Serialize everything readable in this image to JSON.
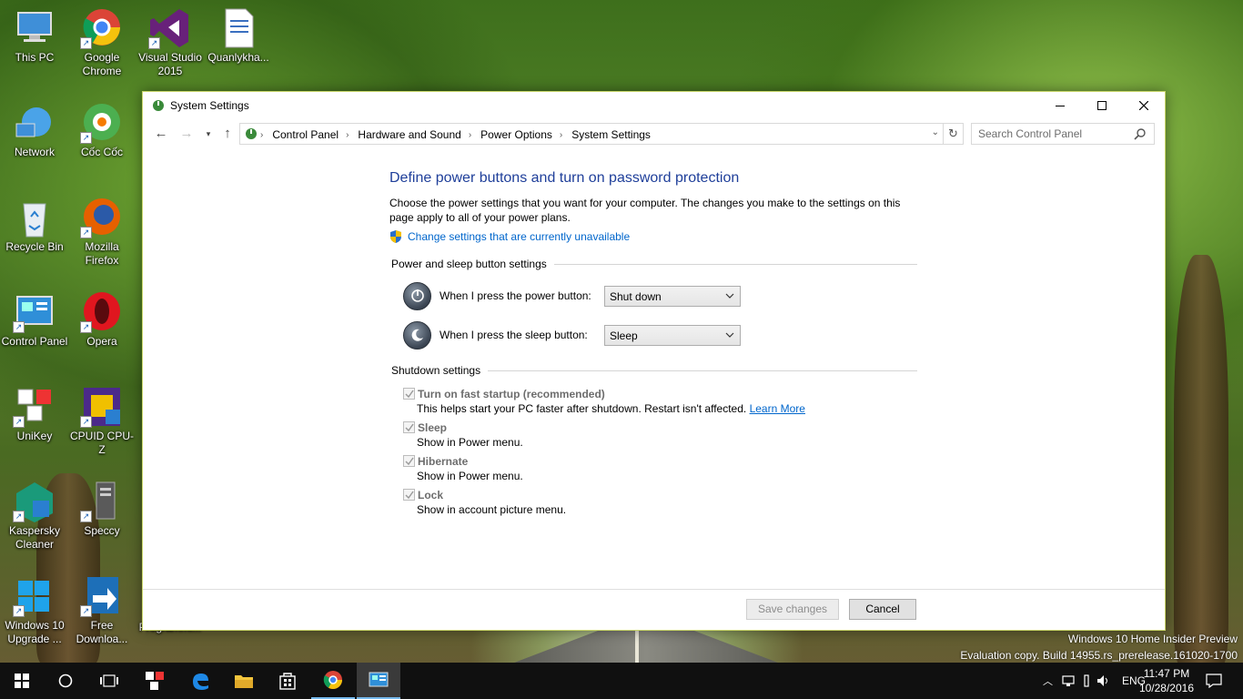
{
  "desktop": {
    "icons": [
      {
        "label": "This PC"
      },
      {
        "label": "Network"
      },
      {
        "label": "Recycle Bin"
      },
      {
        "label": "Control Panel"
      },
      {
        "label": "UniKey"
      },
      {
        "label": "Kaspersky Cleaner"
      },
      {
        "label": "Windows 10 Upgrade ..."
      },
      {
        "label": "Google Chrome"
      },
      {
        "label": "Cốc Cốc"
      },
      {
        "label": "Mozilla Firefox"
      },
      {
        "label": "Opera"
      },
      {
        "label": "CPUID CPU-Z"
      },
      {
        "label": "Speccy"
      },
      {
        "label": "Free Downloa..."
      },
      {
        "label": "Visual Studio 2015"
      },
      {
        "label": "Quanlykha..."
      },
      {
        "label": "Programmi..."
      }
    ]
  },
  "window": {
    "title": "System Settings",
    "breadcrumb": [
      "Control Panel",
      "Hardware and Sound",
      "Power Options",
      "System Settings"
    ],
    "search_placeholder": "Search Control Panel",
    "heading": "Define power buttons and turn on password protection",
    "description": "Choose the power settings that you want for your computer. The changes you make to the settings on this page apply to all of your power plans.",
    "change_link": "Change settings that are currently unavailable",
    "power_section": {
      "title": "Power and sleep button settings",
      "power_label": "When I press the power button:",
      "power_value": "Shut down",
      "sleep_label": "When I press the sleep button:",
      "sleep_value": "Sleep"
    },
    "shutdown_section": {
      "title": "Shutdown settings",
      "items": [
        {
          "title": "Turn on fast startup (recommended)",
          "desc": "This helps start your PC faster after shutdown. Restart isn't affected.",
          "link": "Learn More",
          "checked": true
        },
        {
          "title": "Sleep",
          "desc": "Show in Power menu.",
          "checked": true
        },
        {
          "title": "Hibernate",
          "desc": "Show in Power menu.",
          "checked": true
        },
        {
          "title": "Lock",
          "desc": "Show in account picture menu.",
          "checked": true
        }
      ]
    },
    "save_label": "Save changes",
    "cancel_label": "Cancel"
  },
  "watermark": {
    "line1": "Windows 10 Home Insider Preview",
    "line2": "Evaluation copy. Build 14955.rs_prerelease.161020-1700"
  },
  "taskbar": {
    "language": "ENG",
    "time": "11:47 PM",
    "date": "10/28/2016"
  },
  "colors": {
    "heading": "#1f3f9a",
    "link": "#0066cc",
    "window_border": "#c9d66b",
    "taskbar": "#101010"
  }
}
